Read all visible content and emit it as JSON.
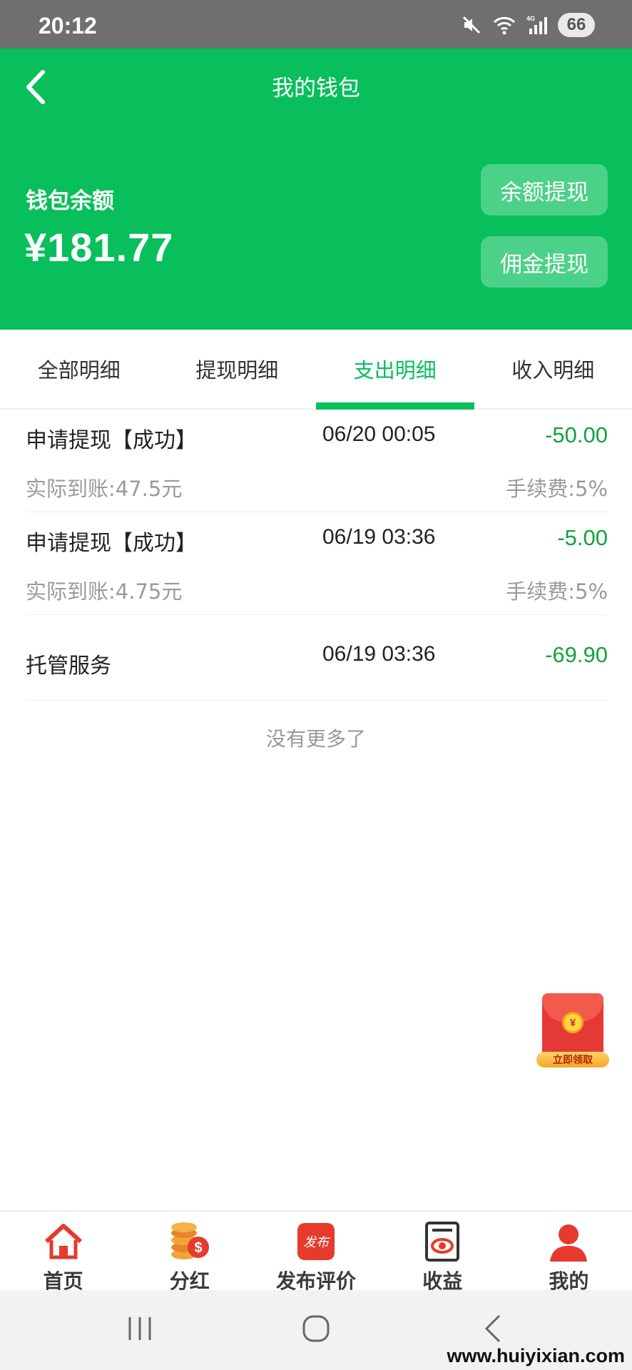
{
  "status_bar": {
    "time": "20:12",
    "battery": "66",
    "network": "4G"
  },
  "header": {
    "title": "我的钱包",
    "balance_label": "钱包余额",
    "balance_value": "¥181.77",
    "withdraw_balance_label": "余额提现",
    "withdraw_commission_label": "佣金提现",
    "color": "#08bf5b"
  },
  "tabs": [
    {
      "label": "全部明细",
      "active": false
    },
    {
      "label": "提现明细",
      "active": false
    },
    {
      "label": "支出明细",
      "active": true
    },
    {
      "label": "收入明细",
      "active": false
    }
  ],
  "records": [
    {
      "title": "申请提现【成功】",
      "time": "06/20 00:05",
      "amount": "-50.00",
      "actual": "实际到账:47.5元",
      "fee": "手续费:5%"
    },
    {
      "title": "申请提现【成功】",
      "time": "06/19 03:36",
      "amount": "-5.00",
      "actual": "实际到账:4.75元",
      "fee": "手续费:5%"
    },
    {
      "title": "托管服务",
      "time": "06/19 03:36",
      "amount": "-69.90"
    }
  ],
  "no_more_text": "没有更多了",
  "red_packet": {
    "coin_symbol": "¥",
    "cta": "立即领取"
  },
  "bottom_nav": [
    {
      "label": "首页",
      "icon": "home-icon"
    },
    {
      "label": "分红",
      "icon": "coins-icon"
    },
    {
      "label": "发布评价",
      "icon": "publish-icon",
      "icon_text": "发布"
    },
    {
      "label": "收益",
      "icon": "earnings-icon"
    },
    {
      "label": "我的",
      "icon": "user-icon"
    }
  ],
  "watermark": "www.huiyixian.com",
  "colors": {
    "accent": "#08bf5b",
    "amount": "#14a13c",
    "nav_icon_red": "#e53a2c"
  }
}
